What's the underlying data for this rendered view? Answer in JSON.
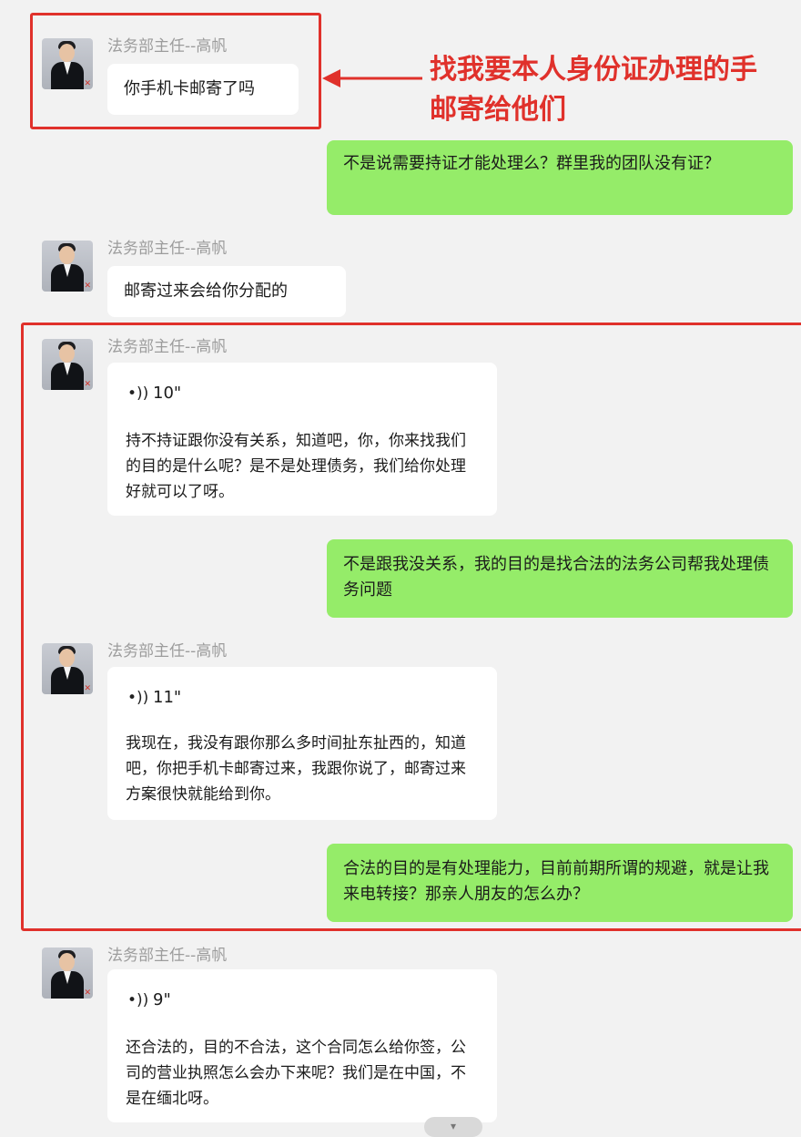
{
  "sender_name": "法务部主任--高帆",
  "avatar_icon": "person-in-suit-avatar",
  "annotation": {
    "line1": "找我要本人身份证办理的手",
    "line2": "邮寄给他们",
    "color": "#e0312b"
  },
  "messages": [
    {
      "type": "text",
      "text": "你手机卡邮寄了吗"
    },
    {
      "type": "sent",
      "text": "不是说需要持证才能处理么？群里我的团队没有证？"
    },
    {
      "type": "text",
      "text": "邮寄过来会给你分配的"
    },
    {
      "type": "voice",
      "duration": "10\"",
      "transcript": "持不持证跟你没有关系，知道吧，你，你来找我们的目的是什么呢？是不是处理债务，我们给你处理好就可以了呀。"
    },
    {
      "type": "sent",
      "text": "不是跟我没关系，我的目的是找合法的法务公司帮我处理债务问题"
    },
    {
      "type": "voice",
      "duration": "11\"",
      "transcript": "我现在，我没有跟你那么多时间扯东扯西的，知道吧，你把手机卡邮寄过来，我跟你说了，邮寄过来方案很快就能给到你。"
    },
    {
      "type": "sent",
      "text": "合法的目的是有处理能力，目前前期所谓的规避，就是让我来电转接？那亲人朋友的怎么办？"
    },
    {
      "type": "voice",
      "duration": "9\"",
      "transcript": "还合法的，目的不合法，这个合同怎么给你签，公司的营业执照怎么会办下来呢？我们是在中国，不是在缅北呀。"
    }
  ],
  "colors": {
    "background": "#f2f2f2",
    "received_bubble": "#ffffff",
    "sent_bubble": "#95ec69",
    "sender_text": "#9c9c9c",
    "highlight": "#e0312b"
  },
  "icons": {
    "voice": "voice-wave-icon",
    "scroll": "chevron-down-icon"
  }
}
